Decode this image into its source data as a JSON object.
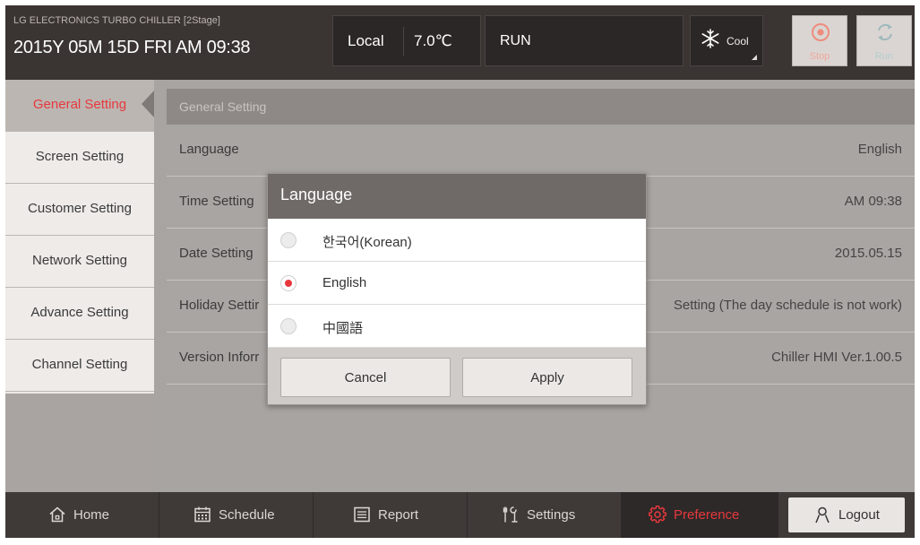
{
  "header": {
    "subtitle": "LG ELECTRONICS TURBO CHILLER [2Stage]",
    "datetime": "2015Y 05M 15D  FRI AM 09:38",
    "mode": "Local",
    "temperature": "7.0℃",
    "status": "RUN",
    "cool_label": "Cool",
    "stop_label": "Stop",
    "run_label": "Run"
  },
  "sidebar": {
    "items": [
      {
        "label": "General Setting"
      },
      {
        "label": "Screen Setting"
      },
      {
        "label": "Customer Setting"
      },
      {
        "label": "Network Setting"
      },
      {
        "label": "Advance Setting"
      },
      {
        "label": "Channel Setting"
      }
    ]
  },
  "main": {
    "title": "General Setting",
    "rows": [
      {
        "key": "Language",
        "value": "English"
      },
      {
        "key": "Time Setting",
        "value": "AM 09:38"
      },
      {
        "key": "Date Setting",
        "value": "2015.05.15"
      },
      {
        "key": "Holiday Settir",
        "value": "Setting (The day schedule is not work)"
      },
      {
        "key": "Version Inforr",
        "value": "Chiller HMI Ver.1.00.5"
      }
    ]
  },
  "dialog": {
    "title": "Language",
    "options": [
      {
        "label": "한국어(Korean)",
        "selected": false
      },
      {
        "label": "English",
        "selected": true
      },
      {
        "label": "中國語",
        "selected": false
      }
    ],
    "cancel_label": "Cancel",
    "apply_label": "Apply"
  },
  "bottom_nav": {
    "items": [
      {
        "label": "Home",
        "icon": "home-icon"
      },
      {
        "label": "Schedule",
        "icon": "calendar-icon"
      },
      {
        "label": "Report",
        "icon": "list-icon"
      },
      {
        "label": "Settings",
        "icon": "wrench-icon"
      },
      {
        "label": "Preference",
        "icon": "gear-icon",
        "active": true
      }
    ],
    "logout_label": "Logout"
  },
  "colors": {
    "accent": "#e8383d",
    "header_bg": "#3a3432",
    "sidebar_bg": "#eeebe9",
    "panel_bg": "#a8a4a1",
    "nav_bg": "#3f3a38"
  }
}
